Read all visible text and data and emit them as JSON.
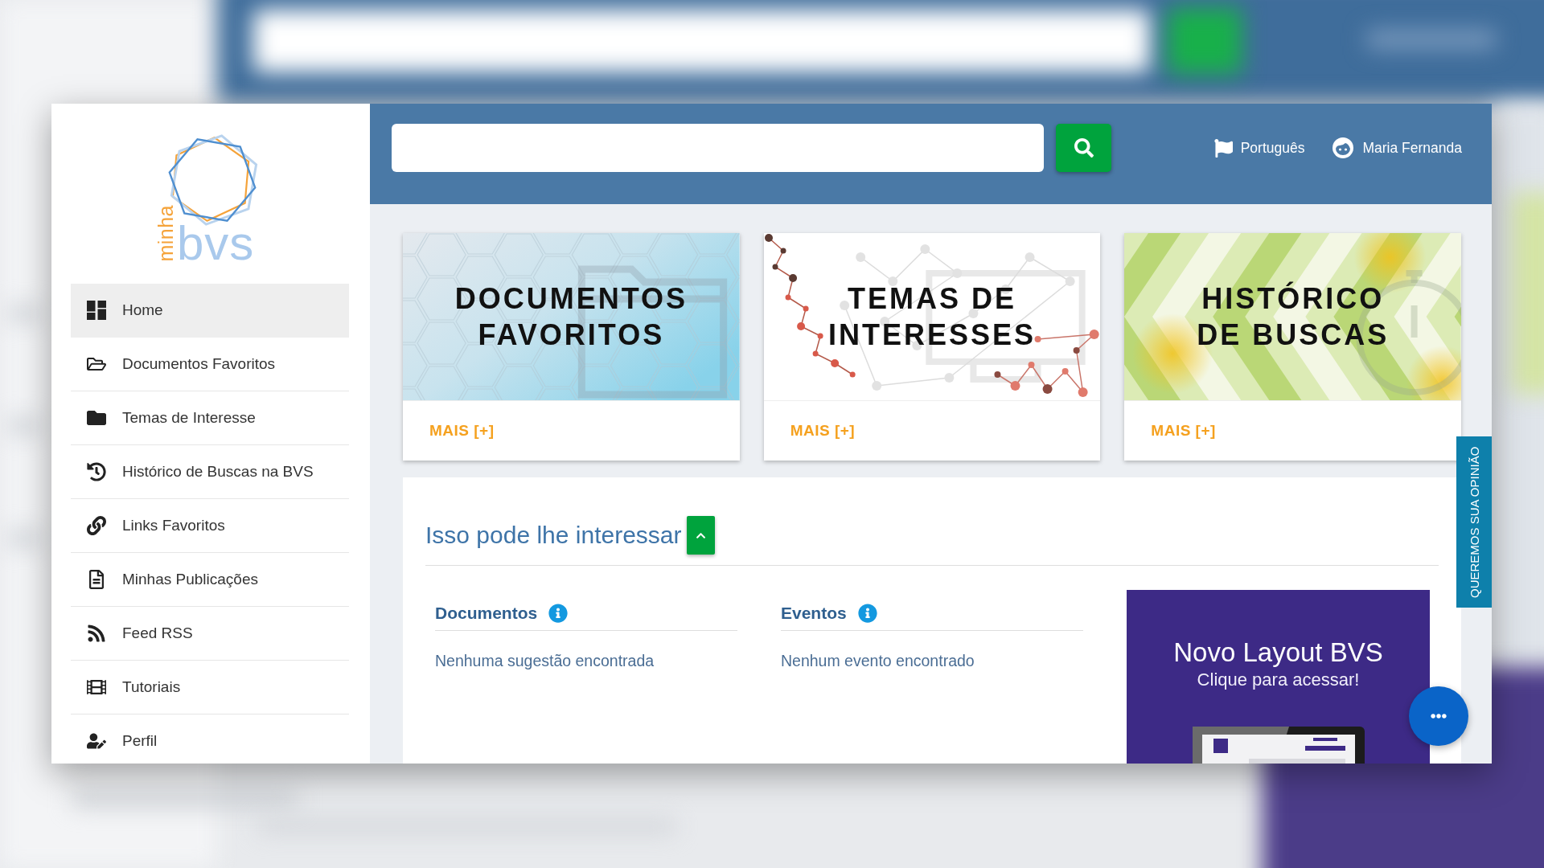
{
  "sidebar": {
    "logo": {
      "prefix": "minha",
      "name": "bvs"
    },
    "items": [
      {
        "label": "Home",
        "selected": true
      },
      {
        "label": "Documentos Favoritos",
        "selected": false
      },
      {
        "label": "Temas de Interesse",
        "selected": false
      },
      {
        "label": "Histórico de Buscas na BVS",
        "selected": false
      },
      {
        "label": "Links Favoritos",
        "selected": false
      },
      {
        "label": "Minhas Publicações",
        "selected": false
      },
      {
        "label": "Feed RSS",
        "selected": false
      },
      {
        "label": "Tutoriais",
        "selected": false
      },
      {
        "label": "Perfil",
        "selected": false
      }
    ]
  },
  "header": {
    "language": "Português",
    "user": "Maria Fernanda"
  },
  "cards": [
    {
      "title": "DOCUMENTOS\nFAVORITOS",
      "link": "MAIS [+]"
    },
    {
      "title": "TEMAS DE\nINTERESSES",
      "link": "MAIS [+]"
    },
    {
      "title": "HISTÓRICO\nDE BUSCAS",
      "link": "MAIS [+]"
    }
  ],
  "suggestions": {
    "title": "Isso pode lhe interessar",
    "expanded": true,
    "columns": [
      {
        "title": "Documentos",
        "message": "Nenhuma sugestão encontrada"
      },
      {
        "title": "Eventos",
        "message": "Nenhum evento encontrado"
      }
    ],
    "banner": {
      "title": "Novo Layout BVS",
      "subtitle": "Clique para acessar!"
    }
  },
  "feedback_tab": "QUEREMOS SUA OPINIÃO"
}
